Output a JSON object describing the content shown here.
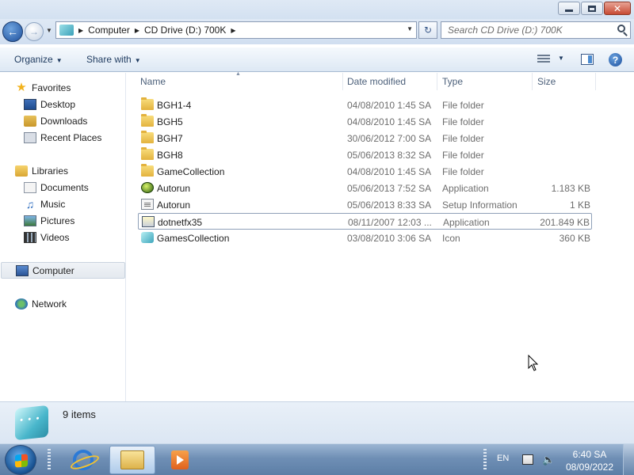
{
  "window": {
    "caption_buttons": {
      "minimize": "minimize",
      "maximize": "maximize",
      "close": "✕"
    }
  },
  "address_bar": {
    "crumbs": [
      "Computer",
      "CD Drive (D:) 700K"
    ],
    "icon": "cd-drive-icon"
  },
  "search": {
    "placeholder": "Search CD Drive (D:) 700K"
  },
  "command_bar": {
    "organize_label": "Organize",
    "share_label": "Share with"
  },
  "nav_pane": {
    "favorites": {
      "label": "Favorites",
      "items": [
        "Desktop",
        "Downloads",
        "Recent Places"
      ]
    },
    "libraries": {
      "label": "Libraries",
      "items": [
        "Documents",
        "Music",
        "Pictures",
        "Videos"
      ]
    },
    "computer": {
      "label": "Computer"
    },
    "network": {
      "label": "Network"
    }
  },
  "file_list": {
    "columns": {
      "name": "Name",
      "date": "Date modified",
      "type": "Type",
      "size": "Size"
    },
    "rows": [
      {
        "name": "BGH1-4",
        "date": "04/08/2010 1:45 SA",
        "type": "File folder",
        "size": "",
        "icon": "folder"
      },
      {
        "name": "BGH5",
        "date": "04/08/2010 1:45 SA",
        "type": "File folder",
        "size": "",
        "icon": "folder"
      },
      {
        "name": "BGH7",
        "date": "30/06/2012 7:00 SA",
        "type": "File folder",
        "size": "",
        "icon": "folder"
      },
      {
        "name": "BGH8",
        "date": "05/06/2013 8:32 SA",
        "type": "File folder",
        "size": "",
        "icon": "folder"
      },
      {
        "name": "GameCollection",
        "date": "04/08/2010 1:45 SA",
        "type": "File folder",
        "size": "",
        "icon": "folder"
      },
      {
        "name": "Autorun",
        "date": "05/06/2013 7:52 SA",
        "type": "Application",
        "size": "1.183 KB",
        "icon": "application"
      },
      {
        "name": "Autorun",
        "date": "05/06/2013 8:33 SA",
        "type": "Setup Information",
        "size": "1 KB",
        "icon": "setup-information"
      },
      {
        "name": "dotnetfx35",
        "date": "08/11/2007 12:03 ...",
        "type": "Application",
        "size": "201.849 KB",
        "icon": "installer"
      },
      {
        "name": "GamesCollection",
        "date": "03/08/2010 3:06 SA",
        "type": "Icon",
        "size": "360 KB",
        "icon": "dice"
      }
    ]
  },
  "details_pane": {
    "item_count": "9 items"
  },
  "taskbar": {
    "apps": [
      "internet-explorer",
      "windows-explorer",
      "media-player"
    ],
    "tray": {
      "language": "EN",
      "time": "6:40 SA",
      "date": "08/09/2022"
    }
  }
}
